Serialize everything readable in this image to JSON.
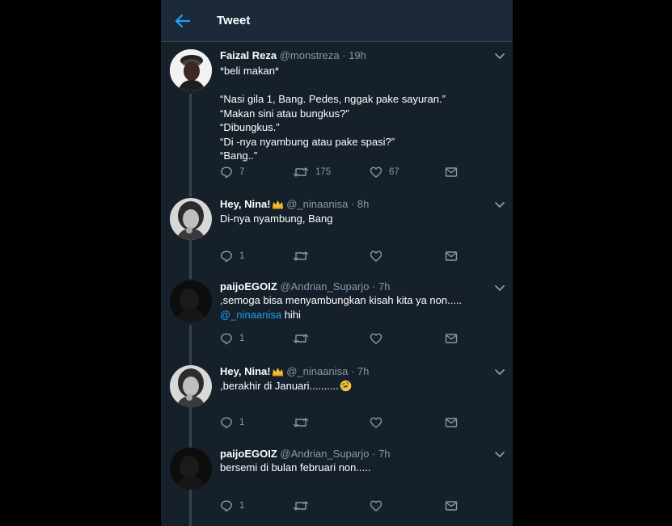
{
  "header": {
    "title": "Tweet"
  },
  "tweets": [
    {
      "name": "Faizal Reza",
      "handle": "@monstreza",
      "time": "19h",
      "lines": [
        "*beli makan*",
        "",
        "“Nasi gila 1, Bang. Pedes, nggak pake sayuran.”",
        "“Makan sini atau bungkus?”",
        "“Dibungkus.”",
        "“Di -nya nyambung atau pake spasi?”",
        "“Bang..”"
      ],
      "replies": "7",
      "retweets": "175",
      "likes": "67"
    },
    {
      "name": "Hey, Nina!",
      "handle": "@_ninaanisa",
      "time": "8h",
      "lines": [
        "Di-nya nyambung, Bang"
      ],
      "replies": "1",
      "retweets": "",
      "likes": ""
    },
    {
      "name": "paijoEGOIZ",
      "handle": "@Andrian_Suparjo",
      "time": "7h",
      "lines": [
        ",semoga bisa menyambungkan kisah kita ya non....."
      ],
      "mention": "@_ninaanisa",
      "mention_suffix": " hihi",
      "replies": "1",
      "retweets": "",
      "likes": ""
    },
    {
      "name": "Hey, Nina!",
      "handle": "@_ninaanisa",
      "time": "7h",
      "lines": [
        ",berakhir di Januari.........."
      ],
      "replies": "1",
      "retweets": "",
      "likes": ""
    },
    {
      "name": "paijoEGOIZ",
      "handle": "@Andrian_Suparjo",
      "time": "7h",
      "lines": [
        "bersemi di bulan februari non....."
      ],
      "replies": "1",
      "retweets": "",
      "likes": ""
    }
  ],
  "separator": "·",
  "icons": {
    "back": "arrow-left-icon",
    "chevron": "chevron-down-icon",
    "reply": "reply-icon",
    "retweet": "retweet-icon",
    "like": "heart-icon",
    "dm": "mail-icon",
    "crown": "crown-emoji-icon",
    "laugh": "rofl-emoji-icon"
  },
  "colors": {
    "background": "#15202b",
    "header": "#1c2938",
    "accent": "#1da1f2",
    "muted": "#8899a6",
    "text": "#ffffff"
  }
}
